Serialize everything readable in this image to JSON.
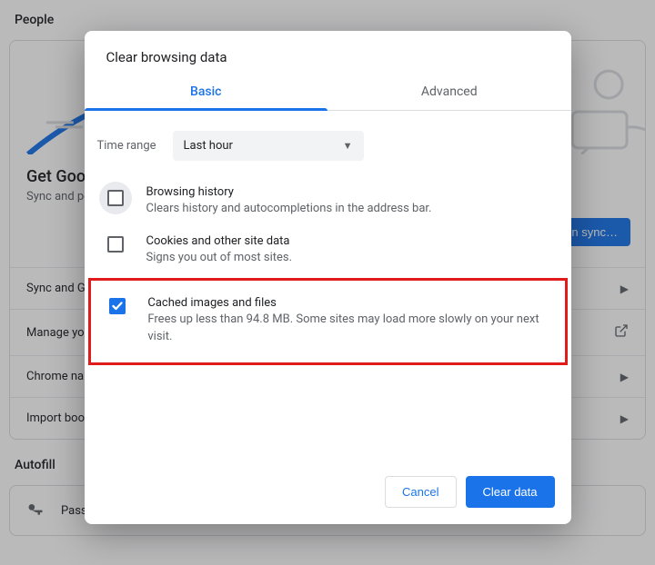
{
  "background": {
    "section1_title": "People",
    "hero": {
      "title": "Get Google smarts in Chrome",
      "sub": "Sync and personalize Chrome across your devices",
      "small_line1": "L",
      "small_line2": "li",
      "sync_button": "Turn on sync…"
    },
    "rows": [
      {
        "label": "Sync and Google services"
      },
      {
        "label": "Manage your Google Account"
      },
      {
        "label": "Chrome name and picture"
      },
      {
        "label": "Import bookmarks and settings"
      }
    ],
    "section2_title": "Autofill",
    "autofill_row": "Passwords"
  },
  "dialog": {
    "title": "Clear browsing data",
    "tabs": {
      "basic": "Basic",
      "advanced": "Advanced"
    },
    "time_label": "Time range",
    "time_value": "Last hour",
    "options": [
      {
        "title": "Browsing history",
        "sub": "Clears history and autocompletions in the address bar.",
        "checked": false,
        "halo": true
      },
      {
        "title": "Cookies and other site data",
        "sub": "Signs you out of most sites.",
        "checked": false,
        "halo": false
      },
      {
        "title": "Cached images and files",
        "sub": "Frees up less than 94.8 MB. Some sites may load more slowly on your next visit.",
        "checked": true,
        "halo": false
      }
    ],
    "cancel": "Cancel",
    "clear": "Clear data"
  }
}
